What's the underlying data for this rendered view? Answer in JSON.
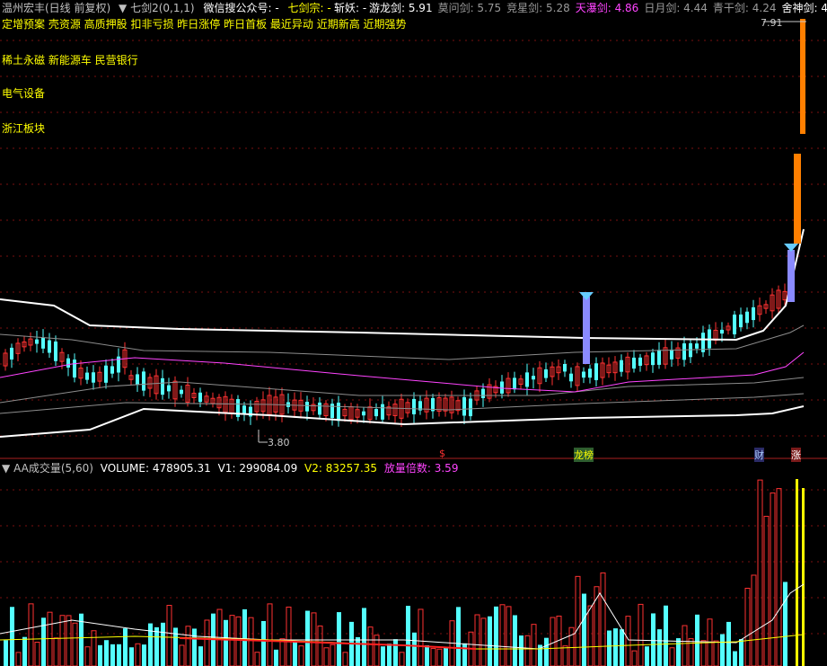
{
  "header": {
    "stock": "温州宏丰(日线 前复权)",
    "indicator_name": "七剑2(0,1,1)",
    "wechat_label": "微信搜公众号:",
    "wechat_value": "-",
    "qijianzong_label": "七剑宗:",
    "qijianzong_value": "-",
    "zhanyao": "斩妖: -",
    "swords": [
      {
        "label": "游龙剑:",
        "value": "5.91",
        "color": "#ffffff"
      },
      {
        "label": "莫问剑:",
        "value": "5.75",
        "color": "#9a9a9a"
      },
      {
        "label": "竞星剑:",
        "value": "5.28",
        "color": "#9a9a9a"
      },
      {
        "label": "天瀑剑:",
        "value": "4.86",
        "color": "#ff44ff"
      },
      {
        "label": "日月剑:",
        "value": "4.44",
        "color": "#9a9a9a"
      },
      {
        "label": "青干剑:",
        "value": "4.24",
        "color": "#9a9a9a"
      },
      {
        "label": "舍神剑:",
        "value": "4",
        "color": "#ffffff"
      }
    ]
  },
  "tags_line": "定增预案 壳资源 高质押股 扣非亏损 昨日涨停 昨日首板 最近异动 近期新高 近期强势",
  "sectors": [
    "稀土永磁 新能源车 民营银行",
    "电气设备",
    "浙江板块"
  ],
  "price_labels": {
    "high": "7.91",
    "low": "3.80"
  },
  "event_markers": [
    "$",
    "龙榜",
    "财",
    "涨"
  ],
  "volume": {
    "title": "AA成交量(5,60)",
    "volume_label": "VOLUME:",
    "volume_value": "478905.31",
    "v1_label": "V1:",
    "v1_value": "299084.09",
    "v2_label": "V2:",
    "v2_value": "83257.35",
    "ratio_label": "放量倍数:",
    "ratio_value": "3.59"
  },
  "colors": {
    "up": "#ff3232",
    "down": "#54ffff",
    "ma_magenta": "#ff44ff",
    "band_white": "#ffffff",
    "band_grey": "#8c8c8c",
    "signal_orange": "#ff7f00",
    "signal_purple": "#8a8aff",
    "header_yellow": "#ffff00"
  },
  "chart_data": {
    "type": "candlestick",
    "y_axis_unit": "price (CNY)",
    "price_extremes": {
      "high": 7.91,
      "low": 3.8
    },
    "volume_summary": {
      "volume": 478905.31,
      "v1": 299084.09,
      "v2": 83257.35,
      "ratio": 3.59
    }
  }
}
